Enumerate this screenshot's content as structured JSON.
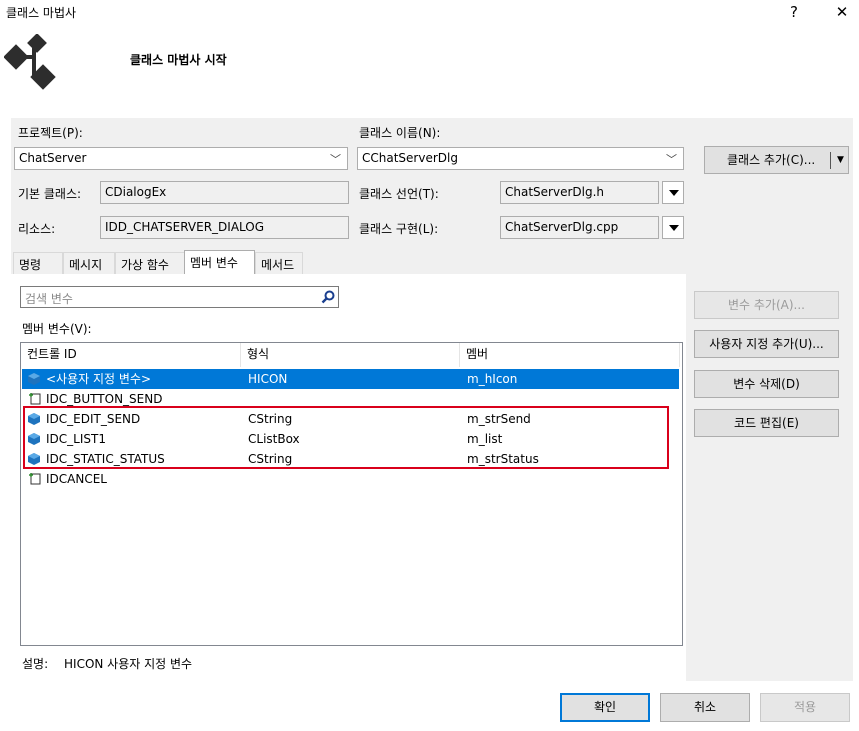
{
  "window": {
    "title": "클래스 마법사",
    "help_glyph": "?",
    "close_glyph": "✕"
  },
  "wizard": {
    "heading": "클래스 마법사 시작"
  },
  "form": {
    "project_label": "프로젝트(P):",
    "project_value": "ChatServer",
    "class_name_label": "클래스 이름(N):",
    "class_name_value": "CChatServerDlg",
    "add_class_label": "클래스 추가(C)...",
    "base_class_label": "기본 클래스:",
    "base_class_value": "CDialogEx",
    "class_decl_label": "클래스 선언(T):",
    "class_decl_value": "ChatServerDlg.h",
    "resource_label": "리소스:",
    "resource_value": "IDD_CHATSERVER_DIALOG",
    "class_impl_label": "클래스 구현(L):",
    "class_impl_value": "ChatServerDlg.cpp"
  },
  "tabs": [
    {
      "label": "명령"
    },
    {
      "label": "메시지"
    },
    {
      "label": "가상 함수"
    },
    {
      "label": "멤버 변수"
    },
    {
      "label": "메서드"
    }
  ],
  "active_tab": "멤버 변수",
  "search": {
    "placeholder": "검색 변수"
  },
  "list": {
    "title": "멤버 변수(V):",
    "columns": [
      "컨트롤 ID",
      "형식",
      "멤버"
    ],
    "rows": [
      {
        "id": "<사용자 지정 변수>",
        "type": "HICON",
        "member": "m_hIcon",
        "icon": "variable-icon",
        "selected": true
      },
      {
        "id": "IDC_BUTTON_SEND",
        "type": "",
        "member": "",
        "icon": "control-icon"
      },
      {
        "id": "IDC_EDIT_SEND",
        "type": "CString",
        "member": "m_strSend",
        "icon": "variable-icon"
      },
      {
        "id": "IDC_LIST1",
        "type": "CListBox",
        "member": "m_list",
        "icon": "variable-icon"
      },
      {
        "id": "IDC_STATIC_STATUS",
        "type": "CString",
        "member": "m_strStatus",
        "icon": "variable-icon"
      },
      {
        "id": "IDCANCEL",
        "type": "",
        "member": "",
        "icon": "control-icon"
      }
    ]
  },
  "side_buttons": {
    "add_variable": "변수 추가(A)...",
    "add_custom": "사용자 지정 추가(U)...",
    "delete_variable": "변수 삭제(D)",
    "edit_code": "코드 편집(E)"
  },
  "description": {
    "label": "설명:",
    "value": "HICON 사용자 지정 변수"
  },
  "footer": {
    "ok": "확인",
    "cancel": "취소",
    "apply": "적용"
  },
  "colors": {
    "selection": "#0078d7",
    "highlight_border": "#d9001b"
  }
}
